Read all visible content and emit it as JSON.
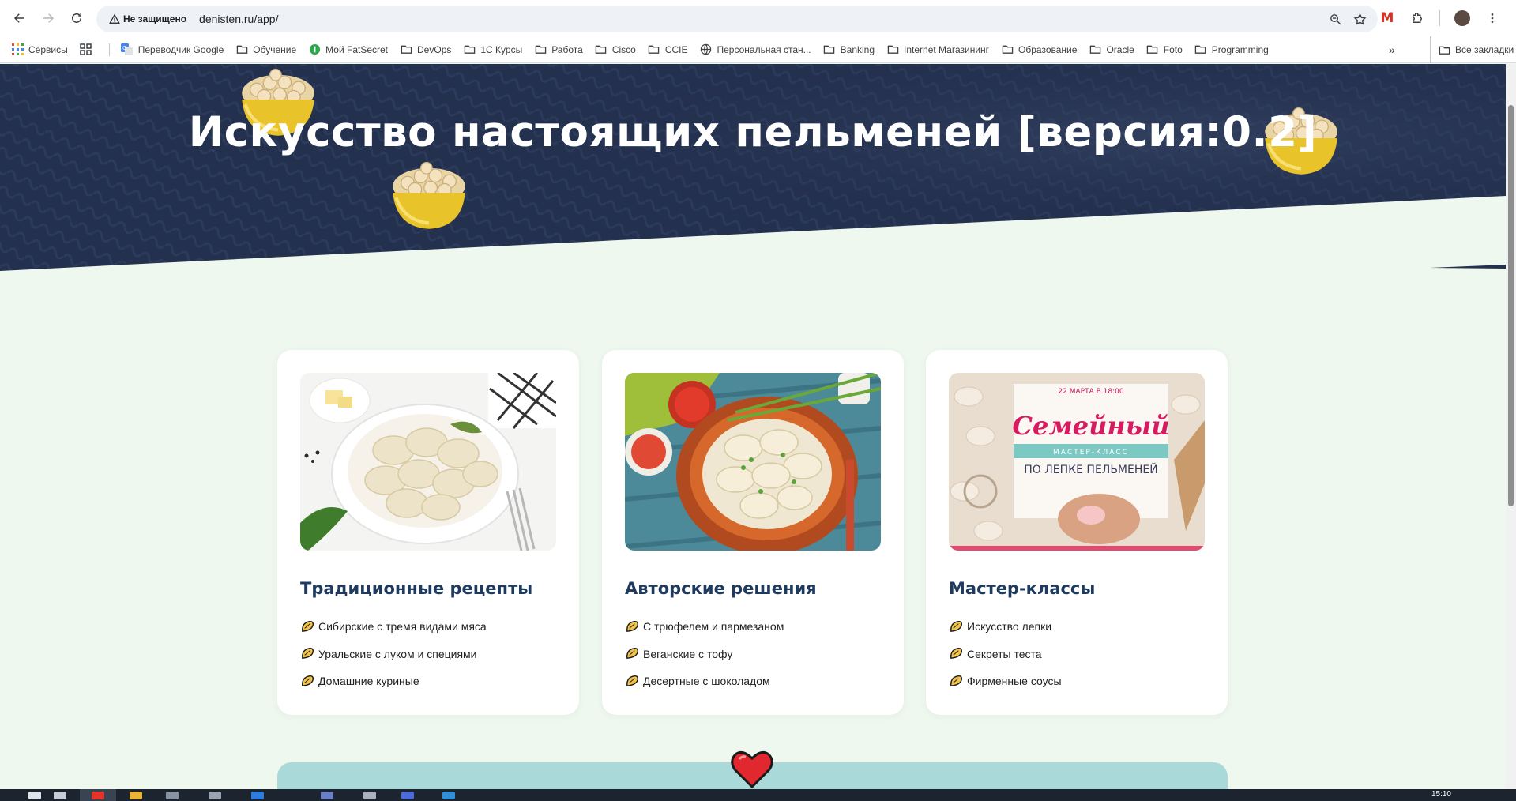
{
  "browser": {
    "security_label": "Не защищено",
    "url": "denisten.ru/app/"
  },
  "bookmarks": {
    "items": [
      {
        "label": "Сервисы",
        "icon": "apps-grid-icon"
      },
      {
        "label": "",
        "icon": "tab-groups-icon"
      },
      {
        "label": "Переводчик Google",
        "icon": "google-translate-icon"
      },
      {
        "label": "Обучение",
        "icon": "folder-icon"
      },
      {
        "label": "Мой FatSecret",
        "icon": "fatsecret-icon"
      },
      {
        "label": "DevOps",
        "icon": "folder-icon"
      },
      {
        "label": "1С Курсы",
        "icon": "folder-icon"
      },
      {
        "label": "Работа",
        "icon": "folder-icon"
      },
      {
        "label": "Cisco",
        "icon": "folder-icon"
      },
      {
        "label": "CCIE",
        "icon": "folder-icon"
      },
      {
        "label": "Персональная стан...",
        "icon": "globe-icon"
      },
      {
        "label": "Banking",
        "icon": "folder-icon"
      },
      {
        "label": "Internet Магазининг",
        "icon": "folder-icon"
      },
      {
        "label": "Образование",
        "icon": "folder-icon"
      },
      {
        "label": "Oracle",
        "icon": "folder-icon"
      },
      {
        "label": "Foto",
        "icon": "folder-icon"
      },
      {
        "label": "Programming",
        "icon": "folder-icon"
      }
    ],
    "more": "»",
    "all_label": "Все закладки"
  },
  "hero": {
    "title": "Искусство настоящих пельменей [версия:0.2]"
  },
  "cards": [
    {
      "title": "Традиционные рецепты",
      "items": [
        "Сибирские с тремя видами мяса",
        "Уральские с луком и специями",
        "Домашние куриные"
      ]
    },
    {
      "title": "Авторские решения",
      "items": [
        "С трюфелем и пармезаном",
        "Веганские с тофу",
        "Десертные с шоколадом"
      ]
    },
    {
      "title": "Мастер-классы",
      "items": [
        "Искусство лепки",
        "Секреты теста",
        "Фирменные соусы"
      ],
      "poster": {
        "date": "22 МАРТА В 18:00",
        "headline": "Семейный",
        "ribbon": "МАСТЕР-КЛАСС",
        "subtitle": "ПО ЛЕПКЕ ПЕЛЬМЕНЕЙ"
      }
    }
  ],
  "taskbar": {
    "time": "15:10"
  },
  "colors": {
    "hero_bg": "#22304f",
    "page_bg": "#eef8ee",
    "card_title": "#1f3a5f",
    "bottom_block": "#a9d9d8",
    "heart": "#e0282e"
  }
}
